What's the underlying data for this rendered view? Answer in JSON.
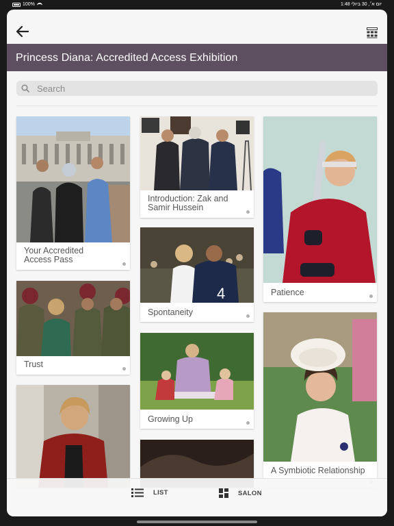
{
  "status": {
    "battery": "100%",
    "time_date": "1:48 יום א׳, 30 ביולי"
  },
  "header": {
    "title": "Princess Diana: Accredited Access Exhibition"
  },
  "search": {
    "placeholder": "Search"
  },
  "cards": [
    {
      "caption": "Your Accredited Access Pass"
    },
    {
      "caption": "Trust"
    },
    {
      "caption": ""
    },
    {
      "caption": "Introduction: Zak and Samir Hussein"
    },
    {
      "caption": "Spontaneity"
    },
    {
      "caption": "Growing Up"
    },
    {
      "caption": ""
    },
    {
      "caption": "Patience"
    },
    {
      "caption": "A Symbiotic Relationship"
    }
  ],
  "tabs": [
    {
      "label": "LIST"
    },
    {
      "label": "SALON"
    }
  ],
  "colors": {
    "title_bar": "#5e4f60",
    "background": "#f6f6f6"
  }
}
